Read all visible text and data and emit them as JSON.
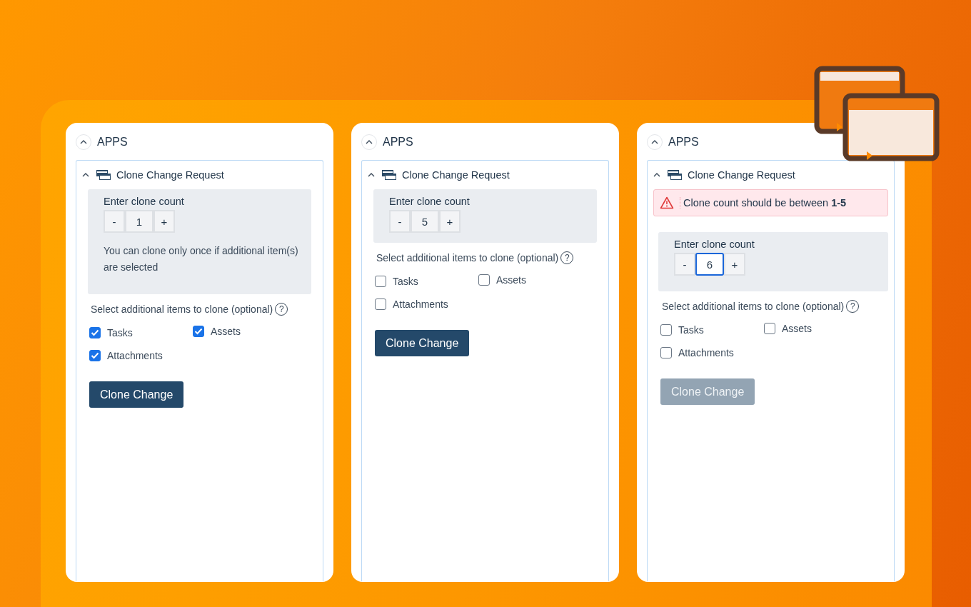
{
  "panels": [
    {
      "section": "APPS",
      "app_title": "Clone Change Request",
      "count_label": "Enter clone count",
      "decrement": "-",
      "count": "1",
      "increment": "+",
      "count_focused": false,
      "hint": "You can clone only once if additional item(s) are selected",
      "options_label": "Select additional items to clone (optional)",
      "help": "?",
      "options": [
        {
          "label": "Tasks",
          "checked": true
        },
        {
          "label": "Assets",
          "checked": true
        },
        {
          "label": "Attachments",
          "checked": true
        }
      ],
      "button": {
        "label": "Clone Change",
        "disabled": false
      }
    },
    {
      "section": "APPS",
      "app_title": "Clone Change Request",
      "count_label": "Enter clone count",
      "decrement": "-",
      "count": "5",
      "increment": "+",
      "count_focused": false,
      "options_label": "Select additional items to clone (optional)",
      "help": "?",
      "options": [
        {
          "label": "Tasks",
          "checked": false
        },
        {
          "label": "Assets",
          "checked": false
        },
        {
          "label": "Attachments",
          "checked": false
        }
      ],
      "button": {
        "label": "Clone Change",
        "disabled": false
      }
    },
    {
      "section": "APPS",
      "app_title": "Clone Change Request",
      "error": "Clone count should be between **1-5**",
      "count_label": "Enter clone count",
      "decrement": "-",
      "count": "6",
      "increment": "+",
      "count_focused": true,
      "options_label": "Select additional items to clone (optional)",
      "help": "?",
      "options": [
        {
          "label": "Tasks",
          "checked": false
        },
        {
          "label": "Assets",
          "checked": false
        },
        {
          "label": "Attachments",
          "checked": false
        }
      ],
      "button": {
        "label": "Clone Change",
        "disabled": true
      }
    }
  ]
}
